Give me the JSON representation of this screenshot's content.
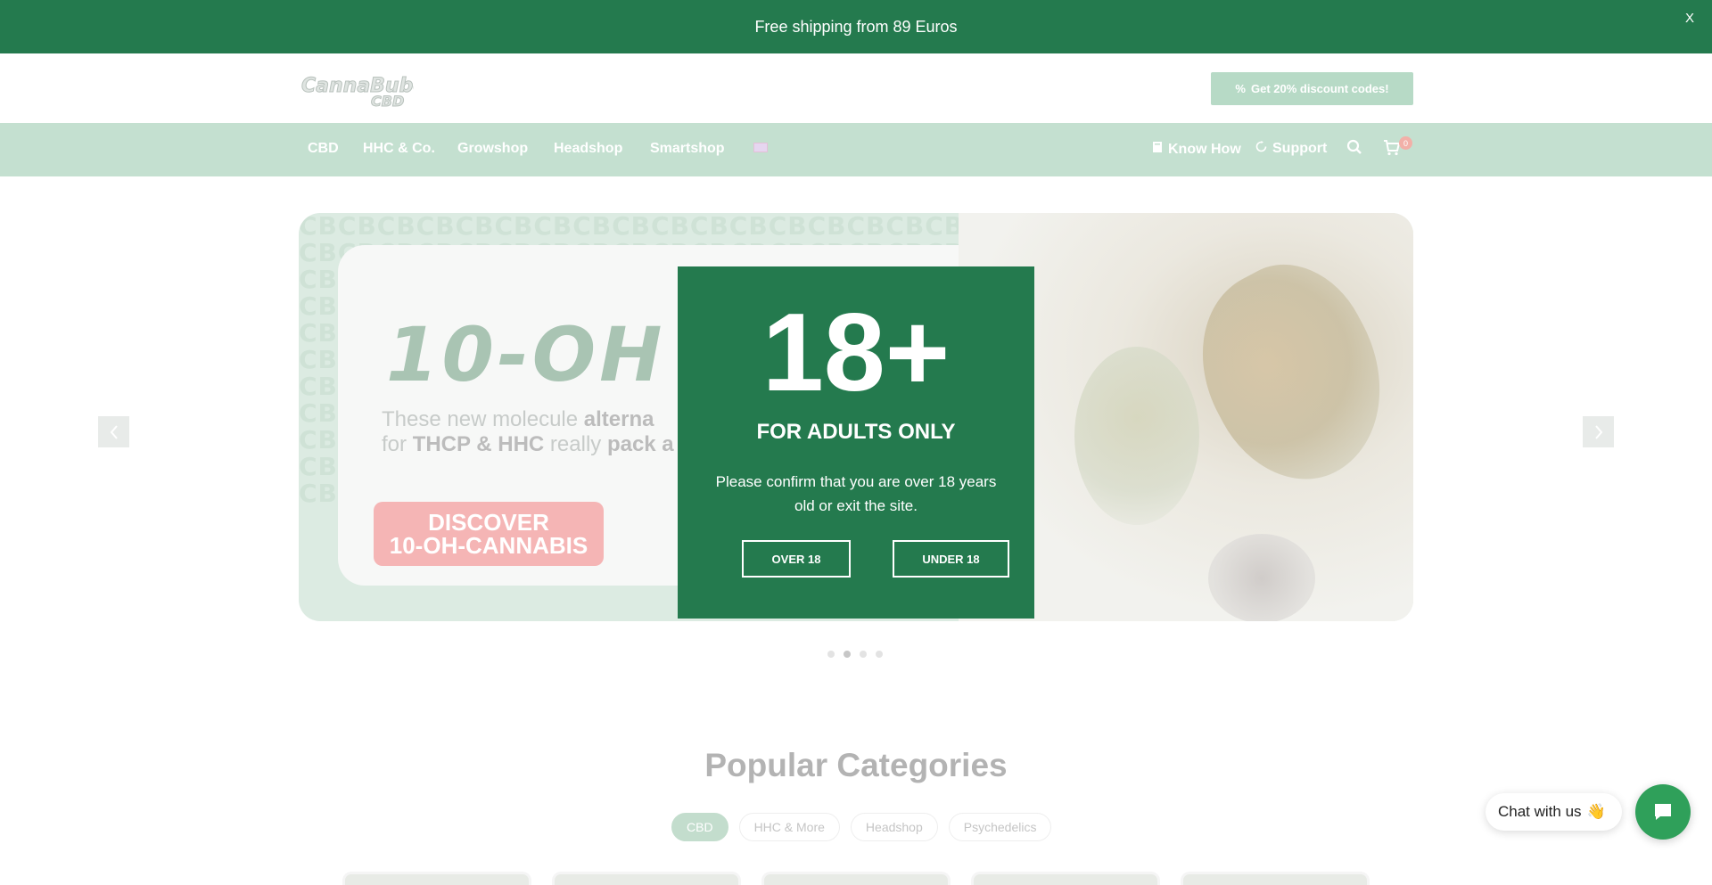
{
  "announcement": {
    "text": "Free shipping from 89 Euros",
    "close": "X"
  },
  "header": {
    "logo_text": "CannaBuben CBD",
    "discount_button": "Get 20% discount codes!"
  },
  "nav": {
    "items": [
      "CBD",
      "HHC & Co.",
      "Growshop",
      "Headshop",
      "Smartshop"
    ],
    "language_flag": "uk-flag-icon",
    "know_how": "Know How",
    "support": "Support",
    "cart_count": "0"
  },
  "hero": {
    "title": "10-OH IS",
    "subtitle_line1_plain": "These new molecule ",
    "subtitle_line1_bold": "alterna",
    "subtitle_line2_bold1": "THCP & HHC",
    "subtitle_line2_plain_a": "for ",
    "subtitle_line2_plain_b": " really ",
    "subtitle_line2_bold2": "pack a",
    "cta_line1": "DISCOVER",
    "cta_line2": "10-OH-CANNABIS",
    "slides": 4,
    "active_slide": 2
  },
  "categories": {
    "title": "Popular Categories",
    "tabs": [
      "CBD",
      "HHC & More",
      "Headshop",
      "Psychedelics"
    ],
    "active_tab": "CBD"
  },
  "age_gate": {
    "big": "18+",
    "subtitle": "FOR ADULTS ONLY",
    "text": "Please confirm that you are over 18 years old or exit the site.",
    "over_button": "OVER 18",
    "under_button": "UNDER 18"
  },
  "chat": {
    "label": "Chat with us",
    "emoji": "👋"
  },
  "colors": {
    "brand_green": "#247a4e",
    "chat_green": "#2fa05a"
  }
}
